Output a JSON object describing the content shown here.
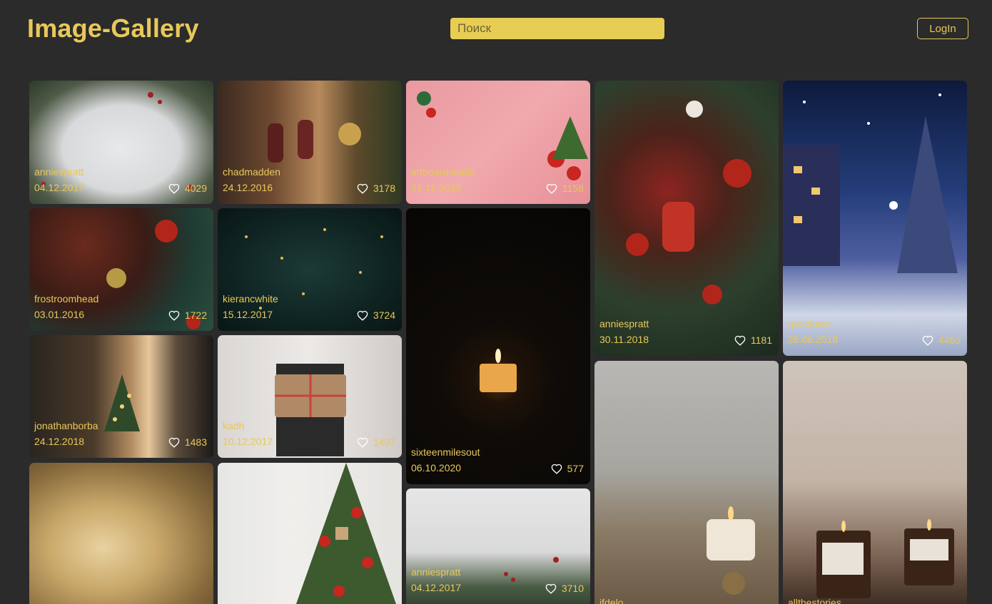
{
  "header": {
    "logo": "Image-Gallery",
    "search_placeholder": "Поиск",
    "login_label": "LogIn"
  },
  "colors": {
    "background": "#2b2b2b",
    "accent": "#e8c85a",
    "search_bg": "#e8cd55"
  },
  "cards": [
    {
      "author": "anniespratt",
      "date": "04.12.2017",
      "likes": "4029",
      "icon": "heart-icon"
    },
    {
      "author": "chadmadden",
      "date": "24.12.2016",
      "likes": "3178",
      "icon": "heart-icon"
    },
    {
      "author": "artboardstudio",
      "date": "21.12.2019",
      "likes": "1158",
      "icon": "heart-icon"
    },
    {
      "author": "frostroomhead",
      "date": "03.01.2016",
      "likes": "1722",
      "icon": "heart-icon"
    },
    {
      "author": "kierancwhite",
      "date": "15.12.2017",
      "likes": "3724",
      "icon": "heart-icon"
    },
    {
      "author": "sixteenmilesout",
      "date": "06.10.2020",
      "likes": "577",
      "icon": "heart-icon"
    },
    {
      "author": "anniespratt",
      "date": "30.11.2018",
      "likes": "1181",
      "icon": "heart-icon"
    },
    {
      "author": "rpnickson",
      "date": "26.06.2018",
      "likes": "4460",
      "icon": "heart-icon"
    },
    {
      "author": "jonathanborba",
      "date": "24.12.2018",
      "likes": "1483",
      "icon": "heart-icon"
    },
    {
      "author": "kadh",
      "date": "10.12.2017",
      "likes": "1407",
      "icon": "heart-icon"
    },
    {
      "author": "anniespratt",
      "date": "04.12.2017",
      "likes": "3710",
      "icon": "heart-icon"
    },
    {
      "author": "",
      "date": "",
      "likes": "",
      "icon": ""
    },
    {
      "author": "",
      "date": "",
      "likes": "",
      "icon": ""
    },
    {
      "author": "jfdelo",
      "date": "",
      "likes": "",
      "icon": ""
    },
    {
      "author": "allthestories",
      "date": "",
      "likes": "",
      "icon": ""
    }
  ]
}
